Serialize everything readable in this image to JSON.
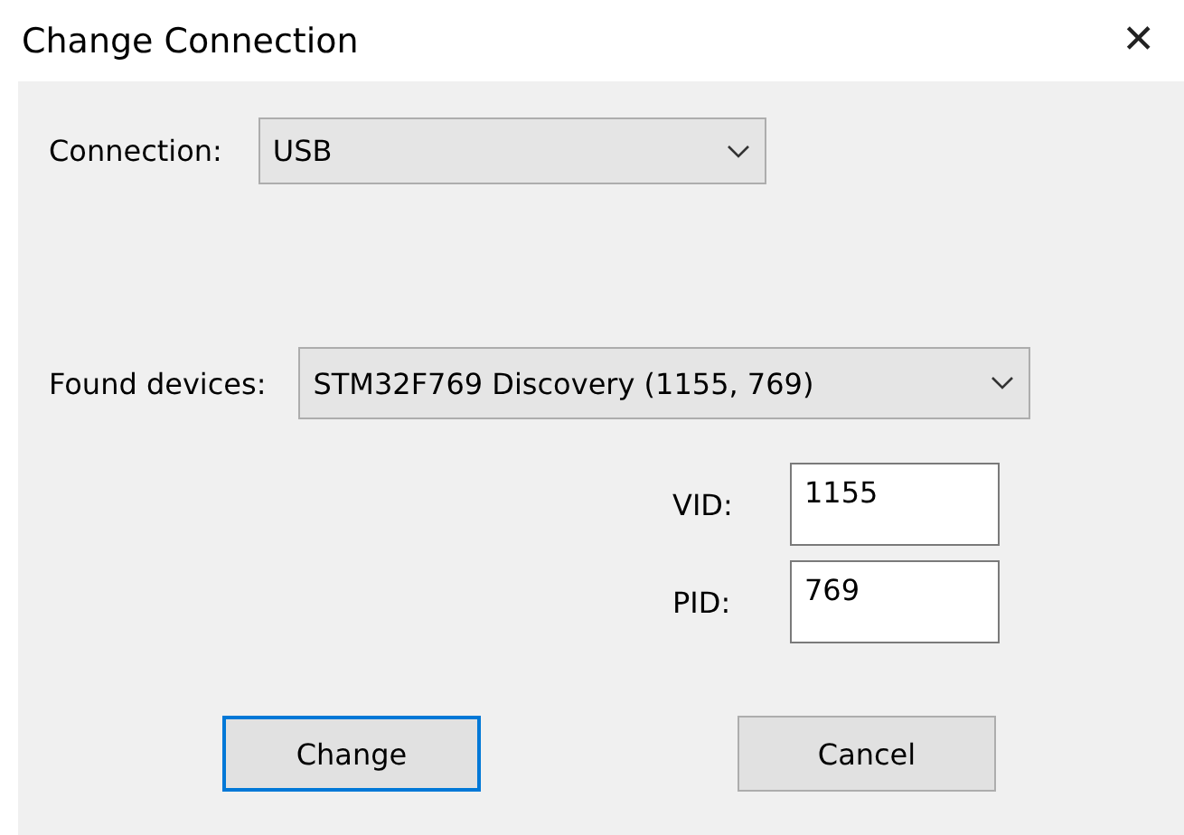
{
  "window": {
    "title": "Change Connection",
    "close": "✕"
  },
  "connection": {
    "label": "Connection:",
    "value": "USB"
  },
  "found_devices": {
    "label": "Found devices:",
    "value": "STM32F769 Discovery (1155, 769)"
  },
  "fields": [
    {
      "label": "VID:",
      "value": "1155"
    },
    {
      "label": "PID:",
      "value": "769"
    }
  ],
  "buttons": [
    {
      "label": "Change",
      "focused": true
    },
    {
      "label": "Cancel",
      "focused": false
    }
  ]
}
